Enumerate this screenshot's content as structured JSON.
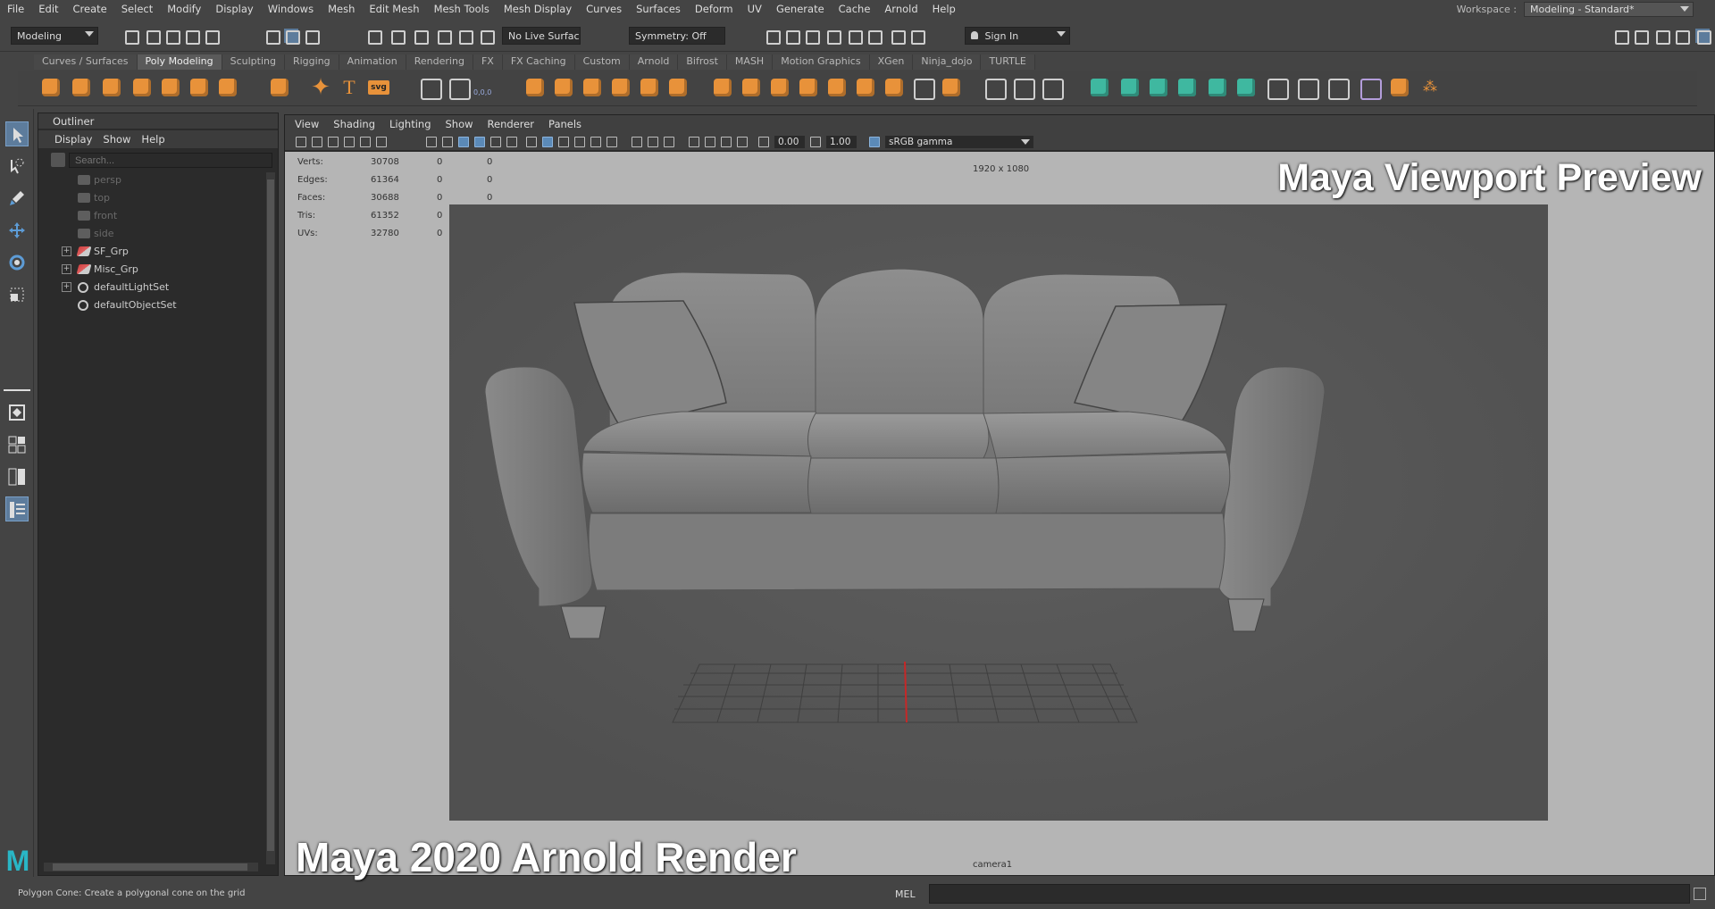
{
  "menubar": {
    "items": [
      "File",
      "Edit",
      "Create",
      "Select",
      "Modify",
      "Display",
      "Windows",
      "Mesh",
      "Edit Mesh",
      "Mesh Tools",
      "Mesh Display",
      "Curves",
      "Surfaces",
      "Deform",
      "UV",
      "Generate",
      "Cache",
      "Arnold",
      "Help"
    ],
    "workspace_label": "Workspace :",
    "workspace_value": "Modeling - Standard*"
  },
  "statusline": {
    "menuset": "Modeling",
    "live_surface": "No Live Surface",
    "symmetry": "Symmetry: Off",
    "sign_in": "Sign In"
  },
  "shelf": {
    "tabs": [
      "Curves / Surfaces",
      "Poly Modeling",
      "Sculpting",
      "Rigging",
      "Animation",
      "Rendering",
      "FX",
      "FX Caching",
      "Custom",
      "Arnold",
      "Bifrost",
      "MASH",
      "Motion Graphics",
      "XGen",
      "Ninja_dojo",
      "TURTLE"
    ],
    "active_tab": "Poly Modeling",
    "text_icon": "T",
    "svg_icon": "svg",
    "coord_icon": "0,0,0"
  },
  "outliner": {
    "title": "Outliner",
    "menu": [
      "Display",
      "Show",
      "Help"
    ],
    "search_placeholder": "Search...",
    "items": [
      {
        "label": "persp",
        "type": "camera"
      },
      {
        "label": "top",
        "type": "camera"
      },
      {
        "label": "front",
        "type": "camera"
      },
      {
        "label": "side",
        "type": "camera"
      },
      {
        "label": "SF_Grp",
        "type": "group"
      },
      {
        "label": "Misc_Grp",
        "type": "group"
      },
      {
        "label": "defaultLightSet",
        "type": "set"
      },
      {
        "label": "defaultObjectSet",
        "type": "set"
      }
    ]
  },
  "viewport": {
    "menu": [
      "View",
      "Shading",
      "Lighting",
      "Show",
      "Renderer",
      "Panels"
    ],
    "field1": "0.00",
    "field2": "1.00",
    "color_space": "sRGB gamma",
    "hud": [
      {
        "label": "Verts:",
        "v1": "30708",
        "v2": "0",
        "v3": "0"
      },
      {
        "label": "Edges:",
        "v1": "61364",
        "v2": "0",
        "v3": "0"
      },
      {
        "label": "Faces:",
        "v1": "30688",
        "v2": "0",
        "v3": "0"
      },
      {
        "label": "Tris:",
        "v1": "61352",
        "v2": "0",
        "v3": "0"
      },
      {
        "label": "UVs:",
        "v1": "32780",
        "v2": "0",
        "v3": "0"
      }
    ],
    "resolution": "1920 x 1080",
    "overlay_top": "Maya Viewport Preview",
    "overlay_bottom": "Maya 2020 Arnold Render",
    "camera": "camera1"
  },
  "helpline": {
    "text": "Polygon Cone: Create a polygonal cone on the grid",
    "cmd_label": "MEL"
  },
  "colors": {
    "accent_orange": "#e8923a",
    "accent_teal": "#3fb8a0",
    "selection_blue": "#5d7c9c",
    "maya_logo": "#29b6c6"
  }
}
